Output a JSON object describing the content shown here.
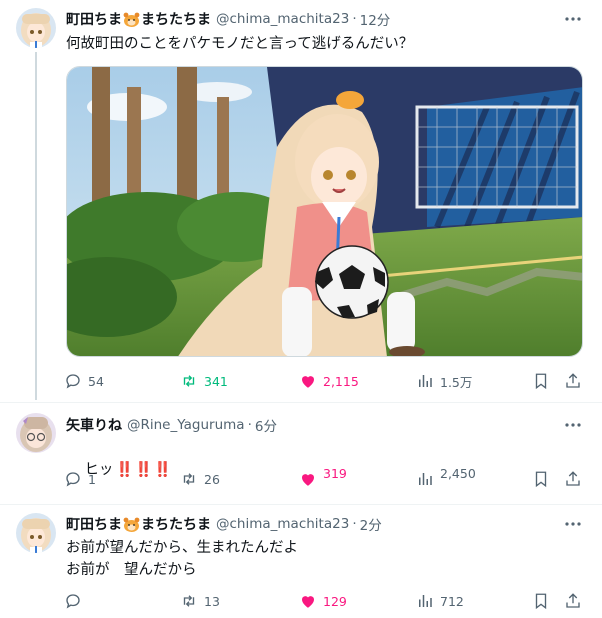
{
  "tweets": [
    {
      "name": "町田ちま",
      "name_suffix": "まちたちま",
      "handle": "@chima_machita23",
      "time": "12分",
      "text": "何故町田のことをパケモノだと言って逃げるんだい？",
      "stats": {
        "reply": "54",
        "retweet": "341",
        "like": "2,115",
        "views": "1.5万"
      }
    },
    {
      "name": "矢車りね",
      "handle": "@Rine_Yaguruma",
      "time": "6分",
      "text": "ヒッ",
      "emphasis": "‼️‼️‼️",
      "stats": {
        "reply": "1",
        "retweet": "26",
        "like": "319",
        "views": "2,450"
      }
    },
    {
      "name": "町田ちま",
      "name_suffix": "まちたちま",
      "handle": "@chima_machita23",
      "time": "2分",
      "text_line1": "お前が望んだから、生まれたんだよ",
      "text_line2": "お前が　望んだから",
      "stats": {
        "reply": "",
        "retweet": "13",
        "like": "129",
        "views": "712"
      }
    }
  ],
  "colors": {
    "retweet_active": "#00ba7c",
    "like_active": "#f91880",
    "muted": "#536471"
  },
  "icons": [
    "reply-icon",
    "retweet-icon",
    "like-icon",
    "views-icon",
    "bookmark-icon",
    "share-icon",
    "more-icon",
    "hamster-emoji",
    "double-exclamation-emoji"
  ]
}
